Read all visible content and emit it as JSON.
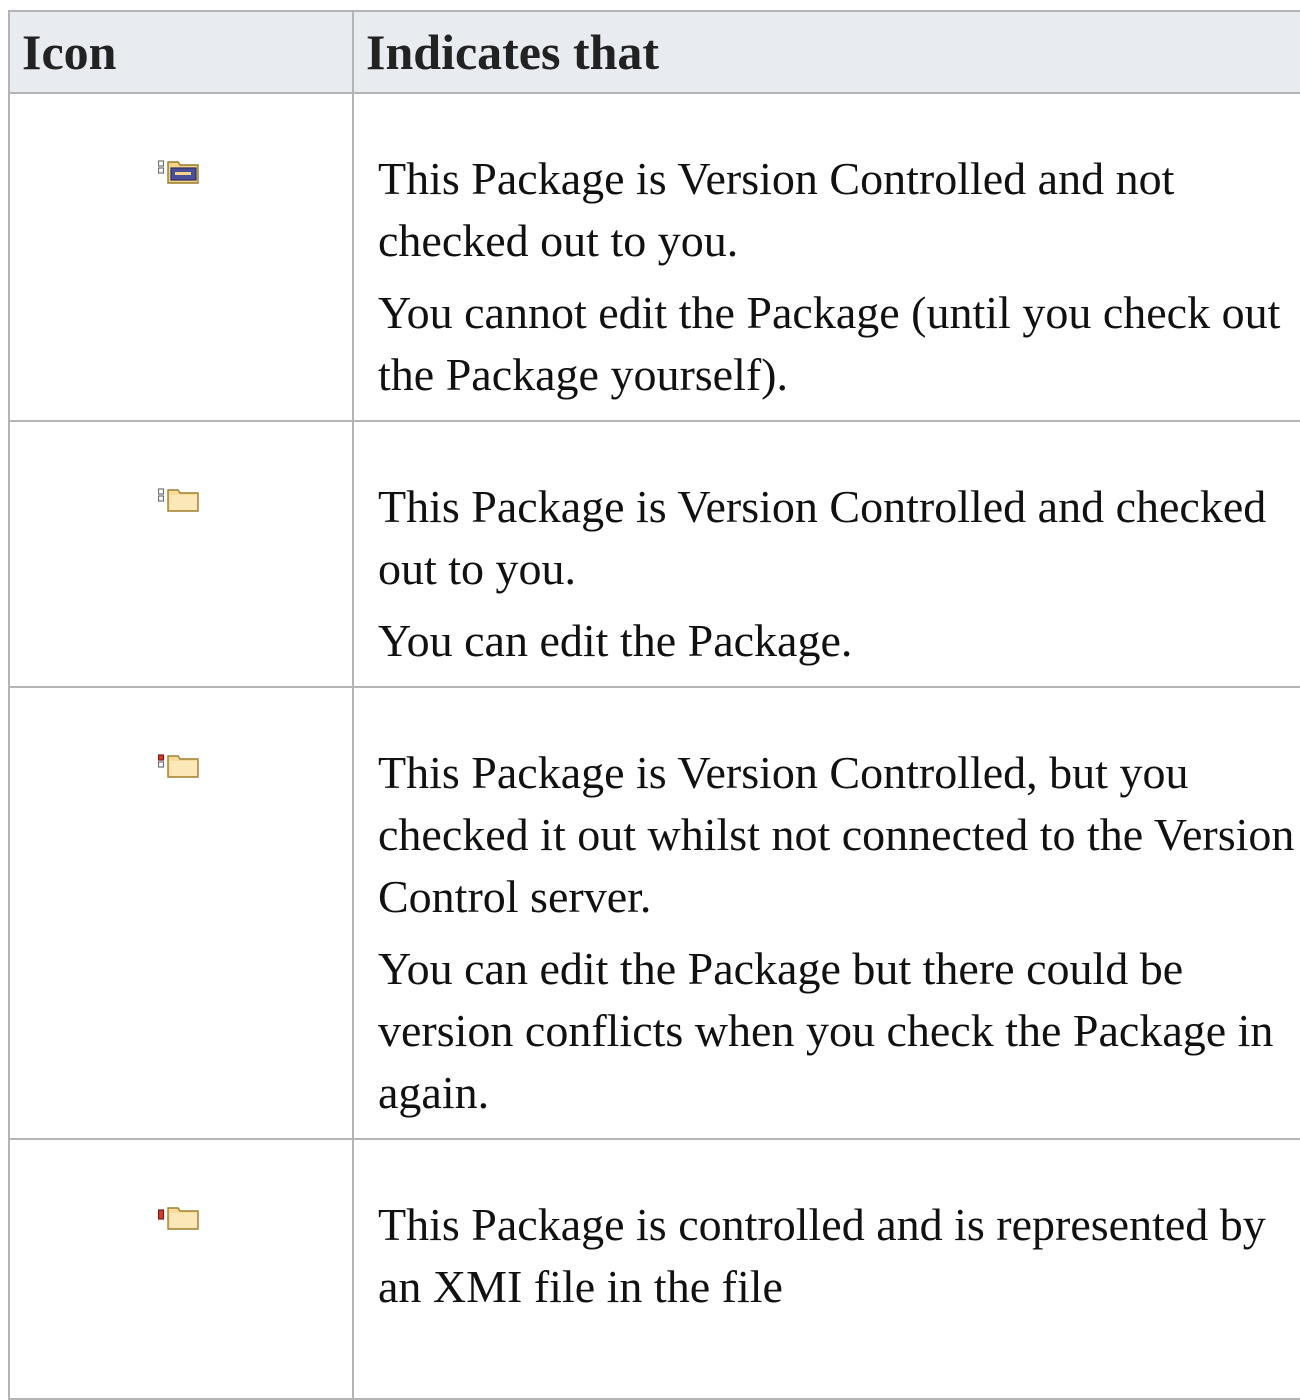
{
  "table": {
    "headers": {
      "icon": "Icon",
      "indicates": "Indicates that"
    },
    "rows": [
      {
        "icon": "package-checked-in-locked-icon",
        "lines": [
          "This Package is Version Controlled and not checked out to you.",
          "You cannot edit the Package (until you check out the Package yourself)."
        ]
      },
      {
        "icon": "package-checked-out-icon",
        "lines": [
          "This Package is Version Controlled and checked out to you.",
          "You can edit the Package."
        ]
      },
      {
        "icon": "package-checked-out-offline-icon",
        "lines": [
          "This Package is Version Controlled, but you checked it out whilst not connected to the Version Control server.",
          "You can edit the Package but there could be version conflicts when you check the Package in again."
        ]
      },
      {
        "icon": "package-controlled-xmi-icon",
        "lines": [
          "This Package is controlled and is represented by an XMI file in the file"
        ]
      }
    ]
  }
}
